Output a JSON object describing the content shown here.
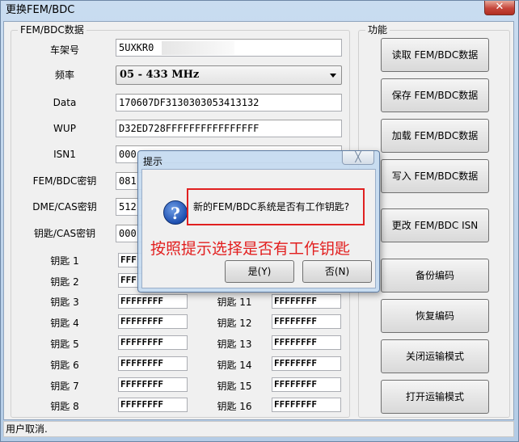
{
  "window": {
    "title": "更换FEM/BDC",
    "close_symbol": "✕"
  },
  "left_group": {
    "title": "FEM/BDC数据",
    "vin_label": "车架号",
    "vin_value": "5UXKR0",
    "freq_label": "频率",
    "freq_value": "05 - 433 MHz",
    "data_label": "Data",
    "data_value": "170607DF3130303053413132",
    "wup_label": "WUP",
    "wup_value": "D32ED728FFFFFFFFFFFFFFFF",
    "isn1_label": "ISN1",
    "isn1_value": "000",
    "fem_key_label": "FEM/BDC密钥",
    "fem_key_value": "081",
    "dme_label": "DME/CAS密钥",
    "dme_value": "512",
    "keycas_label": "钥匙/CAS密钥",
    "keycas_value": "000"
  },
  "keys_left": [
    {
      "label": "钥匙 1",
      "value": "FFF"
    },
    {
      "label": "钥匙 2",
      "value": "FFF"
    },
    {
      "label": "钥匙 3",
      "value": "FFFFFFFF"
    },
    {
      "label": "钥匙 4",
      "value": "FFFFFFFF"
    },
    {
      "label": "钥匙 5",
      "value": "FFFFFFFF"
    },
    {
      "label": "钥匙 6",
      "value": "FFFFFFFF"
    },
    {
      "label": "钥匙 7",
      "value": "FFFFFFFF"
    },
    {
      "label": "钥匙 8",
      "value": "FFFFFFFF"
    }
  ],
  "keys_right": [
    {
      "label": "钥匙 11",
      "value": "FFFFFFFF"
    },
    {
      "label": "钥匙 12",
      "value": "FFFFFFFF"
    },
    {
      "label": "钥匙 13",
      "value": "FFFFFFFF"
    },
    {
      "label": "钥匙 14",
      "value": "FFFFFFFF"
    },
    {
      "label": "钥匙 15",
      "value": "FFFFFFFF"
    },
    {
      "label": "钥匙 16",
      "value": "FFFFFFFF"
    }
  ],
  "right_group": {
    "title": "功能",
    "buttons": [
      "读取 FEM/BDC数据",
      "保存 FEM/BDC数据",
      "加载 FEM/BDC数据",
      "写入 FEM/BDC数据",
      "更改 FEM/BDC ISN",
      "备份编码",
      "恢复编码",
      "关闭运输模式",
      "打开运输模式"
    ]
  },
  "status": {
    "text": "用户取消."
  },
  "dialog": {
    "title": "提示",
    "close_symbol": "╳",
    "icon_glyph": "?",
    "message": "新的FEM/BDC系统是否有工作钥匙?",
    "yes_label": "是(Y)",
    "no_label": "否(N)"
  },
  "annotation": {
    "text": "按照提示选择是否有工作钥匙",
    "color": "#e21e1e"
  }
}
